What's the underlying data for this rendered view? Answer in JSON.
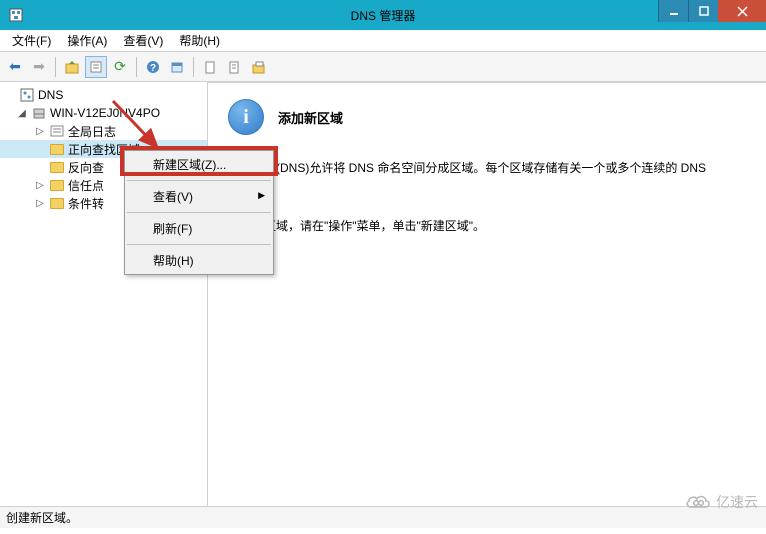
{
  "window": {
    "title": "DNS 管理器"
  },
  "menubar": {
    "file": "文件(F)",
    "action": "操作(A)",
    "view": "查看(V)",
    "help": "帮助(H)"
  },
  "tree": {
    "root": "DNS",
    "server": "WIN-V12EJ0NV4PO",
    "global_log": "全局日志",
    "forward": "正向查找区域",
    "reverse": "反向查",
    "trust": "信任点",
    "cond": "条件转"
  },
  "contextmenu": {
    "new_zone": "新建区域(Z)...",
    "view": "查看(V)",
    "refresh": "刷新(F)",
    "help": "帮助(H)"
  },
  "content": {
    "title": "添加新区域",
    "p1": "统(DNS)允许将 DNS 命名空间分成区域。每个区域存储有关一个或多个连续的 DNS",
    "p1b": "。",
    "p2": "个新区域，请在\"操作\"菜单，单击\"新建区域\"。"
  },
  "statusbar": {
    "text": "创建新区域。"
  },
  "watermark": {
    "text": "亿速云"
  }
}
